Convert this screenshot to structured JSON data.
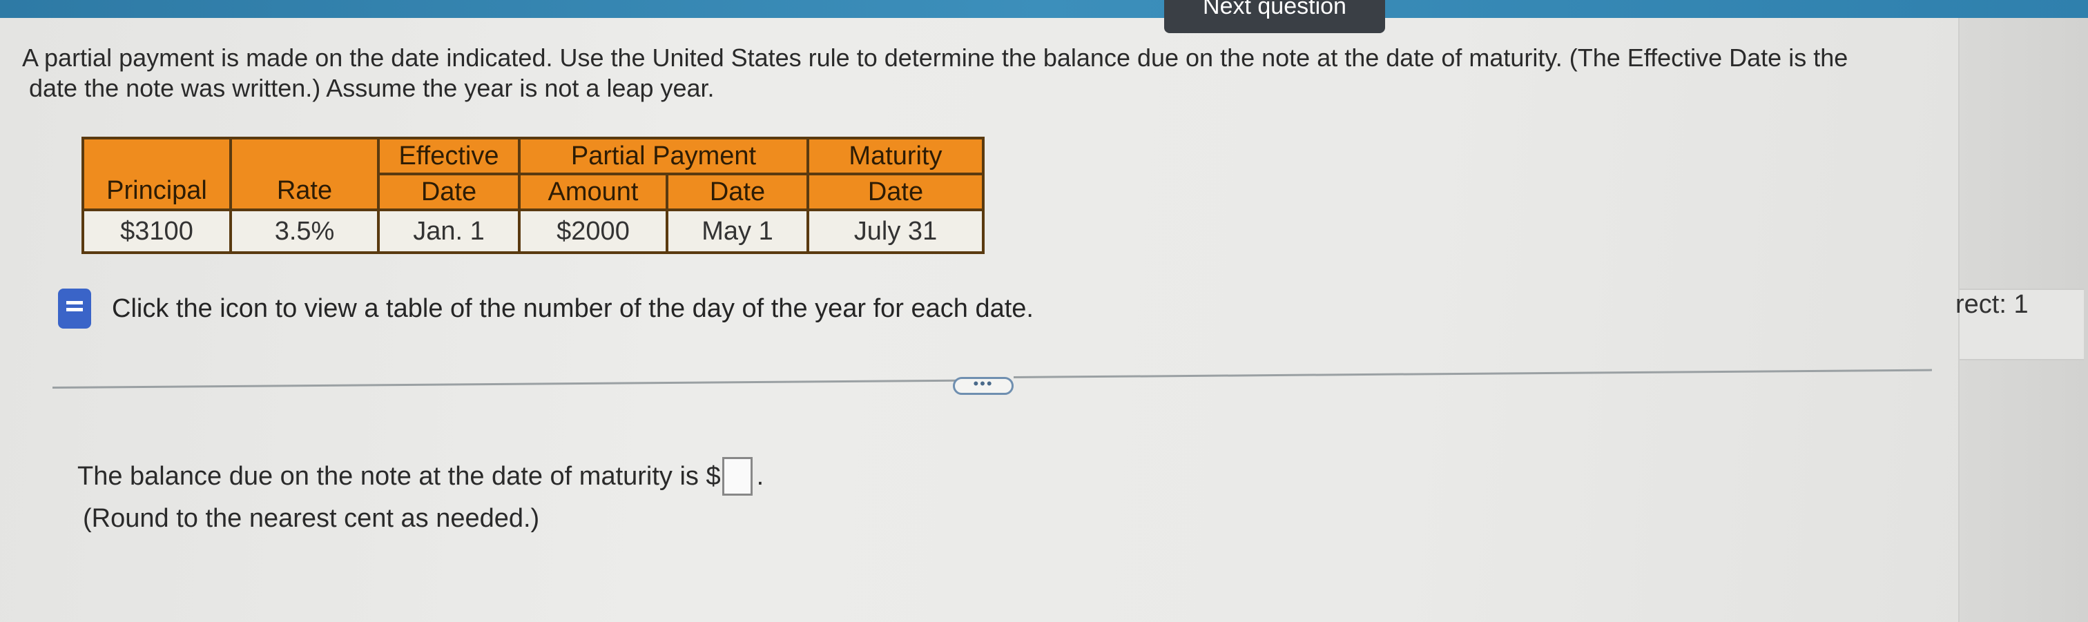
{
  "header": {
    "next_label": "Next question"
  },
  "question": {
    "line1": "A partial payment is made on the date indicated. Use the United States rule to determine the balance due on the note at the date of maturity. (The Effective Date is the",
    "line2": "date the note was written.) Assume the year is not a leap year."
  },
  "table": {
    "headers": {
      "principal": "Principal",
      "rate": "Rate",
      "effective_top": "Effective",
      "effective_bottom": "Date",
      "partial_payment": "Partial Payment",
      "amount": "Amount",
      "date": "Date",
      "maturity_top": "Maturity",
      "maturity_bottom": "Date"
    },
    "row": {
      "principal": "$3100",
      "rate": "3.5%",
      "effective_date": "Jan. 1",
      "amount": "$2000",
      "payment_date": "May 1",
      "maturity_date": "July 31"
    }
  },
  "hint": {
    "text": "Click the icon to view a table of the number of the day of the year for each date."
  },
  "more": {
    "label": "•••"
  },
  "answer": {
    "prefix": "The balance due on the note at the date of maturity is $",
    "suffix": ".",
    "note": "(Round to the nearest cent as needed.)"
  },
  "side": {
    "correct_text": "rect: 1"
  },
  "colors": {
    "table_header": "#ef8c1e",
    "top_bar": "#3c8fbb",
    "icon_blue": "#3a64c8"
  }
}
